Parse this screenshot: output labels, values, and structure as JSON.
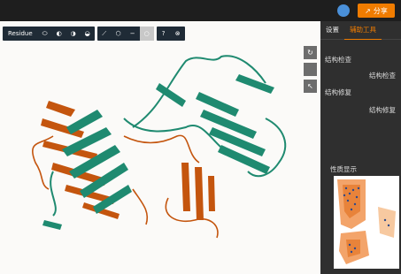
{
  "header": {
    "share_label": "分享",
    "cloud_icon": "cloud-icon",
    "share_icon": "share-icon",
    "accent": "#f07c00"
  },
  "toolbar": {
    "residue_label": "Residue"
  },
  "panel": {
    "tabs": [
      {
        "label": "设置"
      },
      {
        "label": "辅助工具"
      }
    ],
    "sections": [
      {
        "title": "结构检查",
        "button": "结构检查"
      },
      {
        "title": "结构修复",
        "button": "结构修复"
      }
    ],
    "property_title": "性质显示"
  },
  "colors": {
    "helix_strand_green": "#1f8a70",
    "secondary_orange": "#c4550e",
    "background": "#fbfaf8"
  }
}
